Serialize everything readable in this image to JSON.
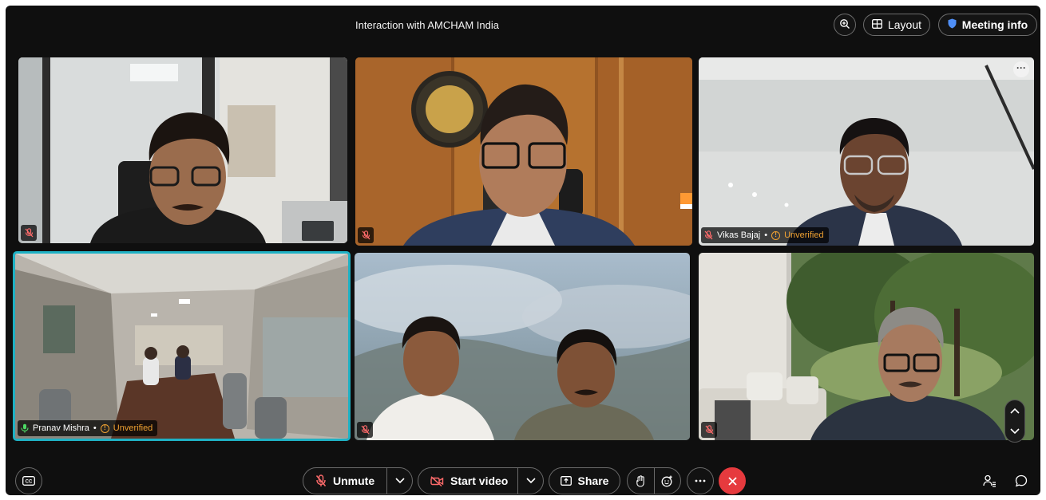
{
  "meeting": {
    "title": "Interaction with AMCHAM India"
  },
  "topbar": {
    "layout_label": "Layout",
    "info_label": "Meeting info"
  },
  "participants": [
    {
      "name": "",
      "muted": true,
      "unverified": false
    },
    {
      "name": "",
      "muted": true,
      "unverified": false
    },
    {
      "name": "Vikas Bajaj",
      "muted": true,
      "unverified": true
    },
    {
      "name": "Pranav Mishra",
      "muted": false,
      "unverified": true
    },
    {
      "name": "",
      "muted": true,
      "unverified": false
    },
    {
      "name": "",
      "muted": true,
      "unverified": false
    }
  ],
  "status": {
    "unverified_label": "Unverified",
    "separator": "•"
  },
  "controls": {
    "unmute_label": "Unmute",
    "start_video_label": "Start video",
    "share_label": "Share"
  },
  "colors": {
    "accent_active": "#1fb1c4",
    "unverified": "#f0a232",
    "end_call": "#e63a3e",
    "muted_icon": "#ff6b6b"
  },
  "icons": [
    "zoom-icon",
    "layout-grid-icon",
    "shield-icon",
    "mic-off-icon",
    "mic-icon",
    "more-icon",
    "chevron-up-icon",
    "chevron-down-icon",
    "captions-icon",
    "video-off-icon",
    "share-icon",
    "raise-hand-icon",
    "reactions-icon",
    "close-icon",
    "participants-icon",
    "chat-icon"
  ]
}
